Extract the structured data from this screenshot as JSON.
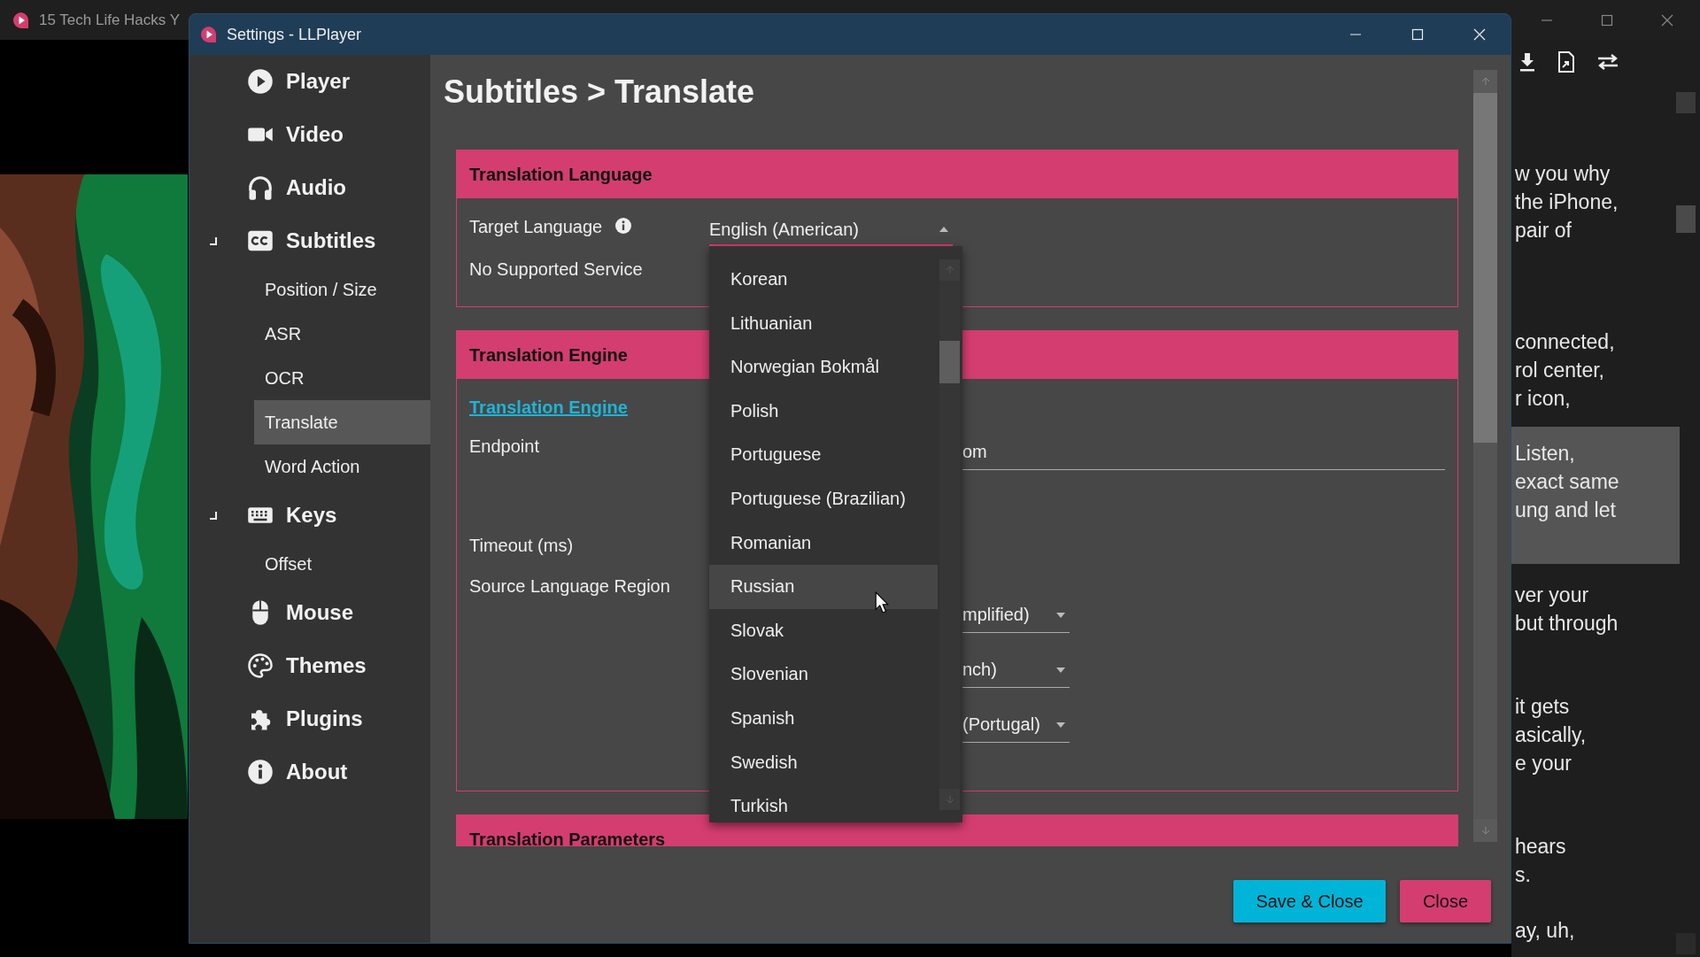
{
  "background_window": {
    "title": "15 Tech Life Hacks Y",
    "transcript": [
      {
        "lines": [
          "w you why",
          "the iPhone,",
          "pair of"
        ],
        "highlighted": false
      },
      {
        "lines": [
          "connected,",
          "rol center,",
          "r icon,"
        ],
        "highlighted": false
      },
      {
        "lines": [
          "Listen,",
          "exact same",
          "ung and let"
        ],
        "highlighted": true
      },
      {
        "lines": [
          "ver your",
          "but through"
        ],
        "highlighted": false
      },
      {
        "lines": [
          "it gets",
          "asically,",
          "e your"
        ],
        "highlighted": false
      },
      {
        "lines": [
          "hears",
          "s."
        ],
        "highlighted": false
      },
      {
        "lines": [
          "ay, uh,"
        ],
        "highlighted": false
      }
    ]
  },
  "settings_window": {
    "title": "Settings - LLPlayer",
    "sidebar": [
      {
        "label": "Player",
        "selected": false,
        "expanded": false
      },
      {
        "label": "Video",
        "selected": false,
        "expanded": false
      },
      {
        "label": "Audio",
        "selected": false,
        "expanded": false
      },
      {
        "label": "Subtitles",
        "selected": false,
        "expanded": true,
        "children": [
          {
            "label": "Position / Size",
            "selected": false
          },
          {
            "label": "ASR",
            "selected": false
          },
          {
            "label": "OCR",
            "selected": false
          },
          {
            "label": "Translate",
            "selected": true
          },
          {
            "label": "Word Action",
            "selected": false
          }
        ]
      },
      {
        "label": "Keys",
        "selected": false,
        "expanded": true,
        "children": [
          {
            "label": "Offset",
            "selected": false
          }
        ]
      },
      {
        "label": "Mouse",
        "selected": false,
        "expanded": false
      },
      {
        "label": "Themes",
        "selected": false,
        "expanded": false
      },
      {
        "label": "Plugins",
        "selected": false,
        "expanded": false
      },
      {
        "label": "About",
        "selected": false,
        "expanded": false
      }
    ],
    "heading": "Subtitles > Translate",
    "sections": [
      {
        "title": "Translation Language",
        "rows": [
          {
            "kind": "select",
            "label": "Target Language",
            "info": true,
            "value": "English (American)",
            "expanded": true,
            "options": [
              {
                "label": "Korean",
                "selected": false
              },
              {
                "label": "Lithuanian",
                "selected": false
              },
              {
                "label": "Norwegian Bokmål",
                "selected": false
              },
              {
                "label": "Polish",
                "selected": false
              },
              {
                "label": "Portuguese",
                "selected": false
              },
              {
                "label": "Portuguese (Brazilian)",
                "selected": false
              },
              {
                "label": "Romanian",
                "selected": false
              },
              {
                "label": "Russian",
                "selected": true
              },
              {
                "label": "Slovak",
                "selected": false
              },
              {
                "label": "Slovenian",
                "selected": false
              },
              {
                "label": "Spanish",
                "selected": false
              },
              {
                "label": "Swedish",
                "selected": false
              },
              {
                "label": "Turkish",
                "selected": false
              }
            ]
          },
          {
            "kind": "label",
            "label": "No Supported Service"
          }
        ]
      },
      {
        "title": "Translation Engine",
        "rows": [
          {
            "kind": "link",
            "label": "Translation Engine"
          },
          {
            "kind": "text",
            "label": "Endpoint",
            "value": "om"
          },
          {
            "kind": "label",
            "label": "Timeout (ms)"
          },
          {
            "kind": "selects",
            "label": "Source Language Region",
            "values": [
              "mplified)",
              "nch)",
              "(Portugal)"
            ]
          }
        ]
      },
      {
        "title": "Translation Parameters"
      }
    ],
    "buttons": [
      {
        "label": "Save & Close",
        "kind": "primary"
      },
      {
        "label": "Close",
        "kind": "danger"
      }
    ]
  }
}
